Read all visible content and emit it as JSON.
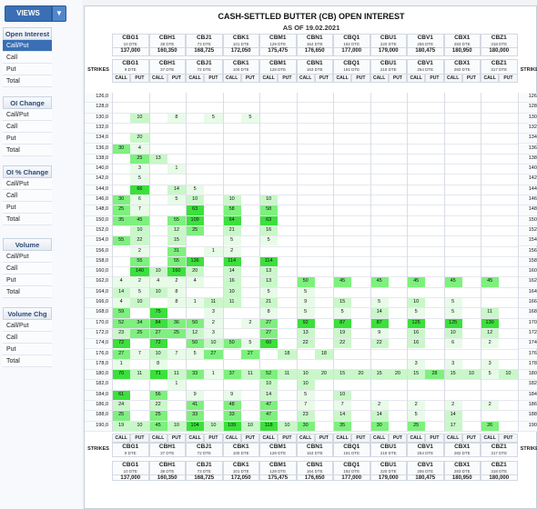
{
  "sidebar": {
    "views_label": "VIEWS",
    "groups": [
      {
        "title": "Open Interest",
        "items": [
          "Call/Put",
          "Call",
          "Put",
          "Total"
        ],
        "selected": 0
      },
      {
        "title": "OI Change",
        "items": [
          "Call/Put",
          "Call",
          "Put",
          "Total"
        ]
      },
      {
        "title": "OI % Change",
        "items": [
          "Call/Put",
          "Call",
          "Put",
          "Total"
        ]
      },
      {
        "title": "Volume",
        "items": [
          "Call/Put",
          "Call",
          "Put",
          "Total"
        ]
      },
      {
        "title": "Volume Chg",
        "items": [
          "Call/Put",
          "Call",
          "Put",
          "Total"
        ]
      }
    ]
  },
  "header": {
    "title": "CASH-SETTLED BUTTER (CB) OPEN INTEREST",
    "subtitle": "AS OF 19.02.2021",
    "strikes_label": "STRIKES",
    "call_label": "CALL",
    "put_label": "PUT"
  },
  "contracts": [
    {
      "name": "CBG1",
      "dte": "10 DTE",
      "dte_low": "9 DTE",
      "underlying": "137,000"
    },
    {
      "name": "CBH1",
      "dte": "38 DTE",
      "dte_low": "37 DTE",
      "underlying": "160,350"
    },
    {
      "name": "CBJ1",
      "dte": "73 DTE",
      "dte_low": "72 DTE",
      "underlying": "168,725"
    },
    {
      "name": "CBK1",
      "dte": "101 DTE",
      "dte_low": "100 DTE",
      "underlying": "172,050"
    },
    {
      "name": "CBM1",
      "dte": "129 DTE",
      "dte_low": "128 DTE",
      "underlying": "175,475"
    },
    {
      "name": "CBN1",
      "dte": "164 DTE",
      "dte_low": "163 DTE",
      "underlying": "176,650"
    },
    {
      "name": "CBQ1",
      "dte": "192 DTE",
      "dte_low": "191 DTE",
      "underlying": "177,000"
    },
    {
      "name": "CBU1",
      "dte": "220 DTE",
      "dte_low": "219 DTE",
      "underlying": "179,000"
    },
    {
      "name": "CBV1",
      "dte": "255 DTE",
      "dte_low": "254 DTE",
      "underlying": "180,475"
    },
    {
      "name": "CBX1",
      "dte": "283 DTE",
      "dte_low": "282 DTE",
      "underlying": "180,950"
    },
    {
      "name": "CBZ1",
      "dte": "318 DTE",
      "dte_low": "317 DTE",
      "underlying": "180,000"
    }
  ],
  "strikes": [
    "126,0",
    "128,0",
    "130,0",
    "132,0",
    "134,0",
    "136,0",
    "138,0",
    "140,0",
    "142,0",
    "144,0",
    "146,0",
    "148,0",
    "150,0",
    "152,0",
    "154,0",
    "156,0",
    "158,0",
    "160,0",
    "162,0",
    "164,0",
    "166,0",
    "168,0",
    "170,0",
    "172,0",
    "174,0",
    "176,0",
    "178,0",
    "180,0",
    "182,0",
    "184,0",
    "186,0",
    "188,0",
    "190,0"
  ],
  "rows": [
    [],
    [],
    [
      [
        1,
        "10"
      ],
      [
        3,
        "8"
      ],
      [
        5,
        "5"
      ],
      [
        7,
        "5"
      ]
    ],
    [],
    [
      [
        1,
        "20"
      ]
    ],
    [
      [
        0,
        "30"
      ],
      [
        1,
        "4"
      ]
    ],
    [
      [
        1,
        "25"
      ],
      [
        2,
        "13"
      ]
    ],
    [
      [
        1,
        "3"
      ],
      [
        3,
        "1"
      ]
    ],
    [
      [
        1,
        "5"
      ]
    ],
    [
      [
        1,
        "66"
      ],
      [
        3,
        "14"
      ],
      [
        4,
        "5"
      ]
    ],
    [
      [
        0,
        "30"
      ],
      [
        1,
        "6"
      ],
      [
        3,
        "5"
      ],
      [
        4,
        "10"
      ],
      [
        6,
        "10"
      ],
      [
        8,
        "10"
      ]
    ],
    [
      [
        0,
        "25"
      ],
      [
        1,
        "7"
      ],
      [
        4,
        "63"
      ],
      [
        6,
        "58"
      ],
      [
        8,
        "58"
      ]
    ],
    [
      [
        0,
        "35"
      ],
      [
        1,
        "45"
      ],
      [
        3,
        "55"
      ],
      [
        4,
        "109"
      ],
      [
        6,
        "64"
      ],
      [
        8,
        "63"
      ]
    ],
    [
      [
        1,
        "10"
      ],
      [
        3,
        "12"
      ],
      [
        4,
        "25"
      ],
      [
        6,
        "21"
      ],
      [
        8,
        "16"
      ]
    ],
    [
      [
        0,
        "55"
      ],
      [
        1,
        "22"
      ],
      [
        3,
        "15"
      ],
      [
        6,
        "5"
      ],
      [
        8,
        "5"
      ]
    ],
    [
      [
        1,
        "2"
      ],
      [
        3,
        "31"
      ],
      [
        5,
        "1"
      ],
      [
        6,
        "2"
      ]
    ],
    [
      [
        1,
        "55"
      ],
      [
        3,
        "55"
      ],
      [
        4,
        "136"
      ],
      [
        6,
        "114"
      ],
      [
        8,
        "114"
      ]
    ],
    [
      [
        1,
        "140"
      ],
      [
        2,
        "10"
      ],
      [
        3,
        "160"
      ],
      [
        4,
        "20"
      ],
      [
        6,
        "14"
      ],
      [
        8,
        "13"
      ]
    ],
    [
      [
        0,
        "4"
      ],
      [
        1,
        "2"
      ],
      [
        2,
        "4"
      ],
      [
        3,
        "2"
      ],
      [
        4,
        "4"
      ],
      [
        6,
        "16"
      ],
      [
        8,
        "13"
      ],
      [
        10,
        "50"
      ],
      [
        12,
        "45"
      ],
      [
        14,
        "45"
      ],
      [
        16,
        "45"
      ],
      [
        18,
        "45"
      ],
      [
        20,
        "45"
      ]
    ],
    [
      [
        0,
        "14"
      ],
      [
        1,
        "5"
      ],
      [
        2,
        "10"
      ],
      [
        3,
        "8"
      ],
      [
        6,
        "10"
      ],
      [
        8,
        "5"
      ],
      [
        10,
        "5"
      ]
    ],
    [
      [
        0,
        "4"
      ],
      [
        1,
        "10"
      ],
      [
        3,
        "8"
      ],
      [
        4,
        "1"
      ],
      [
        5,
        "11"
      ],
      [
        6,
        "11"
      ],
      [
        8,
        "21"
      ],
      [
        10,
        "9"
      ],
      [
        12,
        "15"
      ],
      [
        14,
        "5"
      ],
      [
        16,
        "10"
      ],
      [
        18,
        "5"
      ]
    ],
    [
      [
        0,
        "59"
      ],
      [
        2,
        "75"
      ],
      [
        5,
        "3"
      ],
      [
        8,
        "8"
      ],
      [
        10,
        "5"
      ],
      [
        12,
        "5"
      ],
      [
        14,
        "14"
      ],
      [
        16,
        "5"
      ],
      [
        18,
        "5"
      ],
      [
        20,
        "11"
      ]
    ],
    [
      [
        0,
        "52"
      ],
      [
        1,
        "34"
      ],
      [
        2,
        "84"
      ],
      [
        3,
        "36"
      ],
      [
        4,
        "50"
      ],
      [
        5,
        "2"
      ],
      [
        7,
        "2"
      ],
      [
        8,
        "27"
      ],
      [
        10,
        "92"
      ],
      [
        12,
        "87"
      ],
      [
        14,
        "87"
      ],
      [
        16,
        "125"
      ],
      [
        18,
        "125"
      ],
      [
        20,
        "130"
      ]
    ],
    [
      [
        0,
        "23"
      ],
      [
        1,
        "25"
      ],
      [
        2,
        "27"
      ],
      [
        3,
        "25"
      ],
      [
        4,
        "12"
      ],
      [
        5,
        "3"
      ],
      [
        8,
        "27"
      ],
      [
        10,
        "13"
      ],
      [
        12,
        "19"
      ],
      [
        14,
        "9"
      ],
      [
        16,
        "16"
      ],
      [
        18,
        "10"
      ],
      [
        20,
        "12"
      ]
    ],
    [
      [
        0,
        "72"
      ],
      [
        2,
        "72"
      ],
      [
        4,
        "50"
      ],
      [
        5,
        "10"
      ],
      [
        6,
        "50"
      ],
      [
        7,
        "5"
      ],
      [
        8,
        "60"
      ],
      [
        10,
        "22"
      ],
      [
        12,
        "22"
      ],
      [
        14,
        "22"
      ],
      [
        16,
        "16"
      ],
      [
        18,
        "6"
      ],
      [
        20,
        "2"
      ]
    ],
    [
      [
        0,
        "27"
      ],
      [
        1,
        "7"
      ],
      [
        2,
        "10"
      ],
      [
        3,
        "7"
      ],
      [
        4,
        "5"
      ],
      [
        5,
        "27"
      ],
      [
        7,
        "27"
      ],
      [
        9,
        "18"
      ],
      [
        11,
        "18"
      ]
    ],
    [
      [
        0,
        "1"
      ],
      [
        2,
        "8"
      ],
      [
        16,
        "3"
      ],
      [
        18,
        "3"
      ],
      [
        20,
        "3"
      ]
    ],
    [
      [
        0,
        "70"
      ],
      [
        1,
        "11"
      ],
      [
        2,
        "71"
      ],
      [
        3,
        "11"
      ],
      [
        4,
        "33"
      ],
      [
        5,
        "1"
      ],
      [
        6,
        "37"
      ],
      [
        7,
        "11"
      ],
      [
        8,
        "52"
      ],
      [
        9,
        "11"
      ],
      [
        10,
        "10"
      ],
      [
        11,
        "20"
      ],
      [
        12,
        "15"
      ],
      [
        13,
        "20"
      ],
      [
        14,
        "15"
      ],
      [
        15,
        "20"
      ],
      [
        16,
        "15"
      ],
      [
        17,
        "28"
      ],
      [
        18,
        "15"
      ],
      [
        19,
        "10"
      ],
      [
        20,
        "5"
      ],
      [
        21,
        "10"
      ]
    ],
    [
      [
        3,
        "1"
      ],
      [
        8,
        "10"
      ],
      [
        10,
        "10"
      ]
    ],
    [
      [
        0,
        "61"
      ],
      [
        2,
        "56"
      ],
      [
        4,
        "9"
      ],
      [
        6,
        "9"
      ],
      [
        8,
        "14"
      ],
      [
        10,
        "5"
      ],
      [
        12,
        "10"
      ]
    ],
    [
      [
        0,
        "24"
      ],
      [
        2,
        "22"
      ],
      [
        4,
        "41"
      ],
      [
        6,
        "48"
      ],
      [
        8,
        "47"
      ],
      [
        10,
        "7"
      ],
      [
        12,
        "7"
      ],
      [
        14,
        "2"
      ],
      [
        16,
        "2"
      ],
      [
        18,
        "2"
      ],
      [
        20,
        "2"
      ]
    ],
    [
      [
        0,
        "25"
      ],
      [
        2,
        "25"
      ],
      [
        4,
        "33"
      ],
      [
        6,
        "33"
      ],
      [
        8,
        "47"
      ],
      [
        10,
        "23"
      ],
      [
        12,
        "14"
      ],
      [
        14,
        "14"
      ],
      [
        16,
        "5"
      ],
      [
        18,
        "14"
      ]
    ],
    [
      [
        0,
        "19"
      ],
      [
        1,
        "10"
      ],
      [
        2,
        "45"
      ],
      [
        3,
        "10"
      ],
      [
        4,
        "104"
      ],
      [
        5,
        "10"
      ],
      [
        6,
        "109"
      ],
      [
        7,
        "10"
      ],
      [
        8,
        "118"
      ],
      [
        9,
        "10"
      ],
      [
        10,
        "30"
      ],
      [
        12,
        "35"
      ],
      [
        14,
        "30"
      ],
      [
        16,
        "25"
      ],
      [
        18,
        "17"
      ],
      [
        20,
        "26"
      ]
    ]
  ],
  "colors": {
    "accent": "#3a6fb5",
    "green_strong": "#3ce03c",
    "green_mid": "#7ef07e",
    "green_light": "#c9f7c9",
    "green_pale": "#e8fbe8",
    "yellow_pale": "#fafac8"
  },
  "footer_note": "mirrored contract header at bottom"
}
